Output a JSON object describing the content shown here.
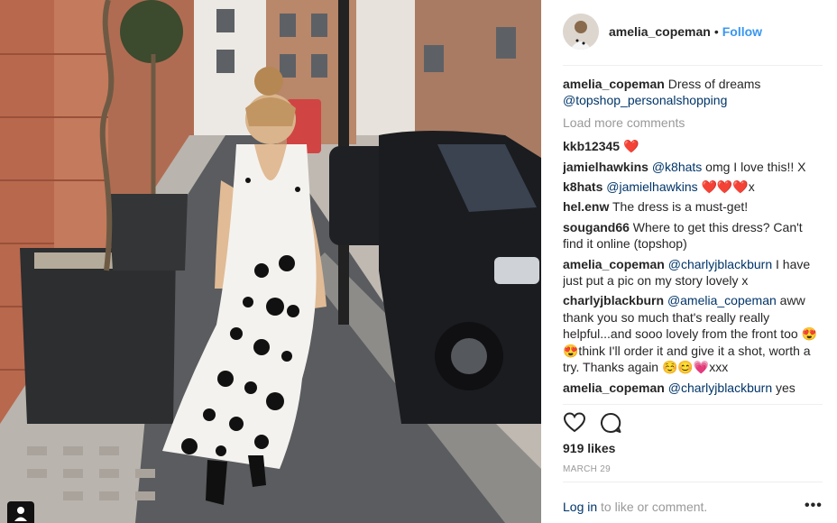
{
  "header": {
    "username": "amelia_copeman",
    "separator": "•",
    "follow_label": "Follow"
  },
  "caption": {
    "username": "amelia_copeman",
    "text": " Dress of dreams ",
    "mention": "@topshop_personalshopping"
  },
  "load_more_label": "Load more comments",
  "comments": [
    {
      "user": "kkb12345",
      "mention": "",
      "text": " ❤️"
    },
    {
      "user": "jamielhawkins",
      "mention": "@k8hats",
      "text": " omg I love this!! X"
    },
    {
      "user": "k8hats",
      "mention": "@jamielhawkins",
      "text": " ❤️❤️❤️x"
    },
    {
      "user": "hel.enw",
      "mention": "",
      "text": " The dress is a must-get!"
    },
    {
      "user": "sougand66",
      "mention": "",
      "text": " Where to get this dress? Can't find it online (topshop)"
    },
    {
      "user": "amelia_copeman",
      "mention": "@charlyjblackburn",
      "text": " I have just put a pic on my story lovely x"
    },
    {
      "user": "charlyjblackburn",
      "mention": "@amelia_copeman",
      "text": " aww thank you so much that's really really helpful...and sooo lovely from the front too 😍😍think I'll order it and give it a shot, worth a try. Thanks again ☺️😊💗xxx"
    },
    {
      "user": "amelia_copeman",
      "mention": "@charlyjblackburn",
      "text": " yes"
    }
  ],
  "likes_label": "919 likes",
  "date_label": "MARCH 29",
  "login": {
    "link_label": "Log in",
    "rest": " to like or comment."
  },
  "more_label": "•••",
  "icons": {
    "like": "heart-outline-icon",
    "comment": "speech-bubble-icon",
    "usertag": "person-icon",
    "more": "ellipsis-icon"
  },
  "colors": {
    "link_blue": "#3897f0",
    "mention_blue": "#003569",
    "muted_gray": "#999999",
    "text": "#262626"
  }
}
